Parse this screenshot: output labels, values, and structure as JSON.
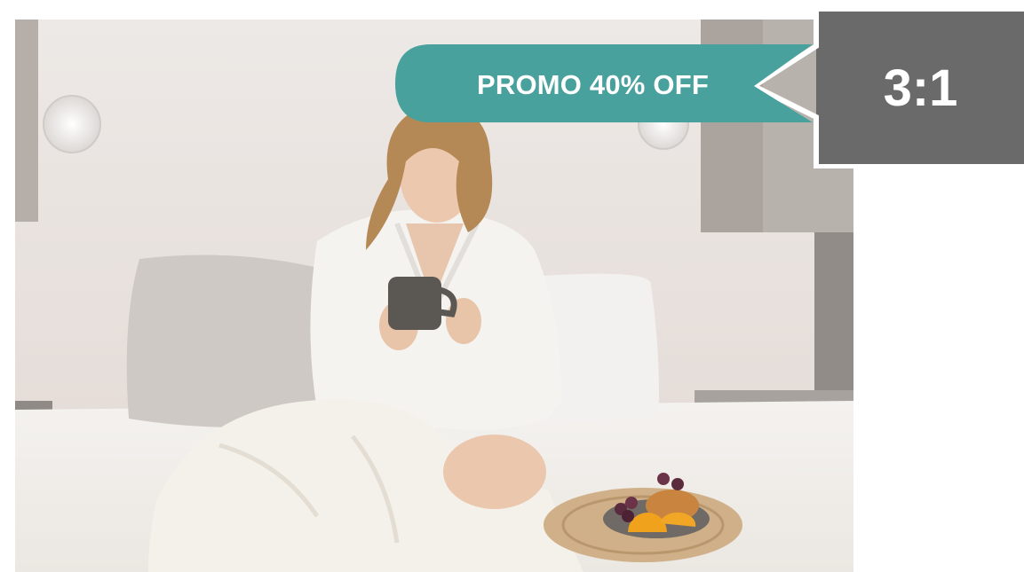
{
  "banner": {
    "promo_label": "PROMO 40% OFF",
    "ratio_label": "3:1"
  },
  "colors": {
    "promo_fill": "#48a19d",
    "ratio_fill": "#6a6a6a",
    "outline": "#ffffff"
  },
  "photo": {
    "subject": "woman-in-bathrobe-with-mug-on-bed-icon"
  }
}
